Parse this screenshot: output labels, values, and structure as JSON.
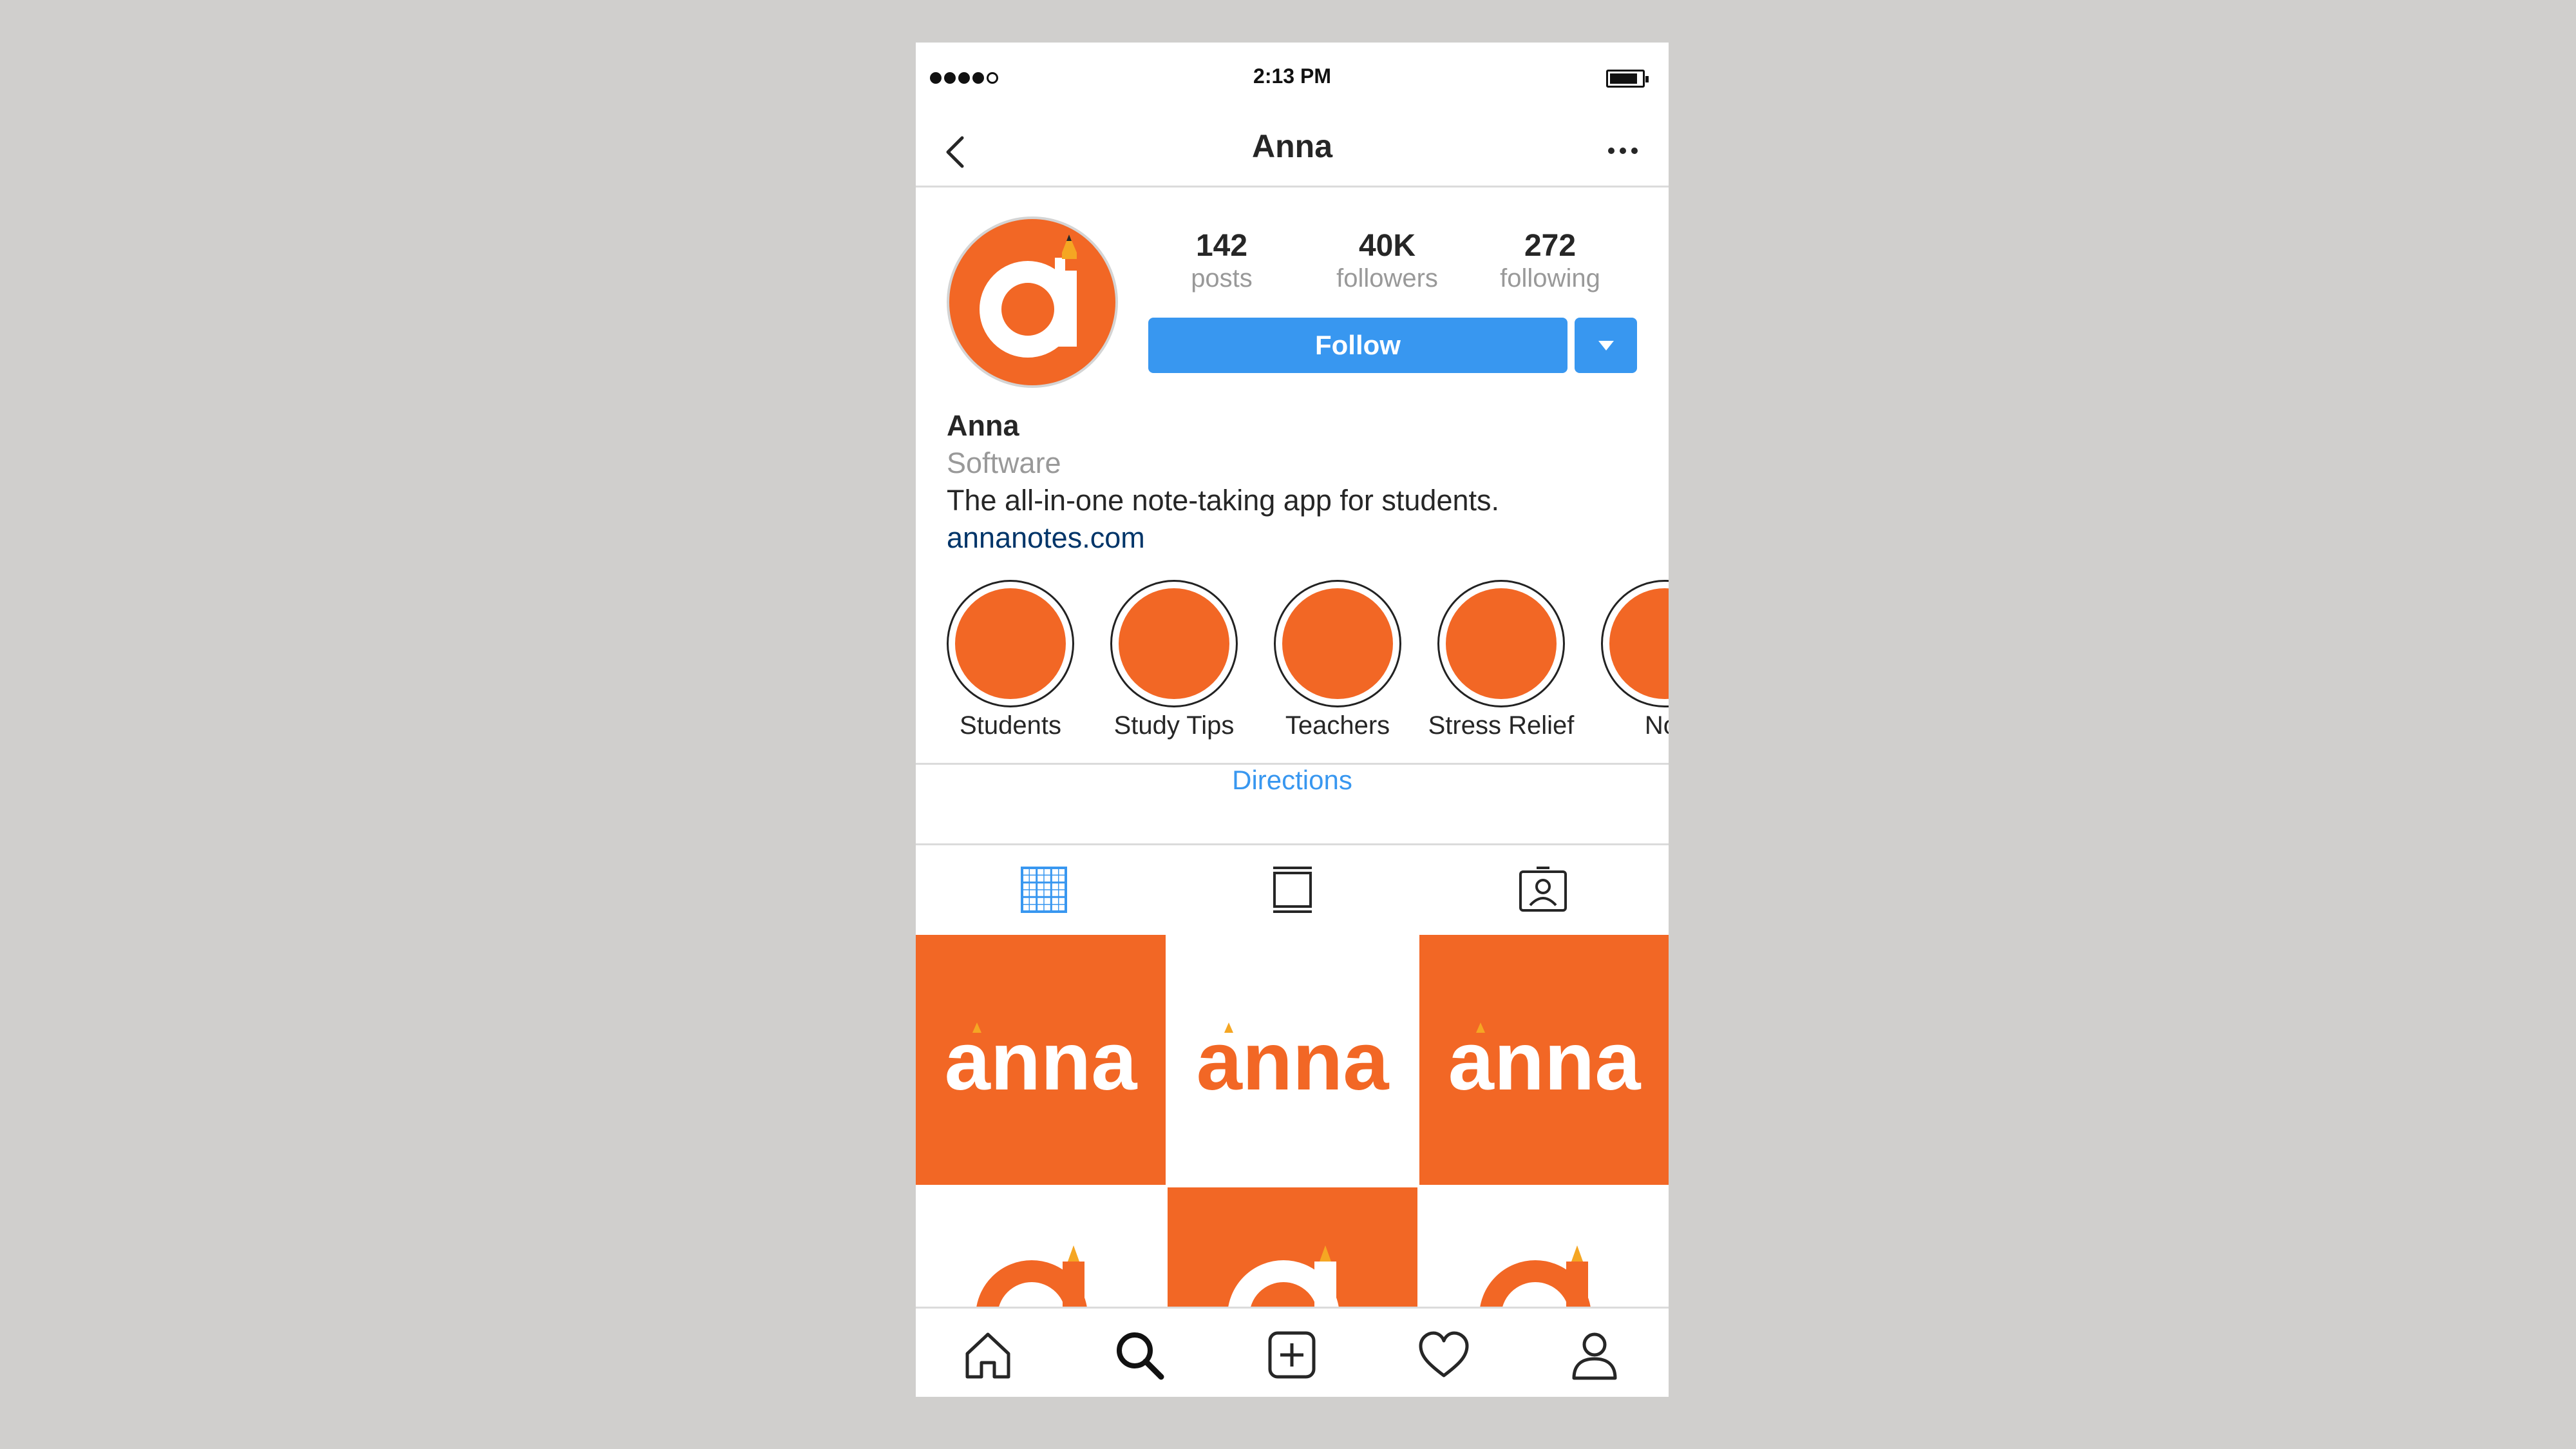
{
  "status_bar": {
    "time": "2:13 PM"
  },
  "header": {
    "title": "Anna"
  },
  "profile": {
    "stats": [
      {
        "value": "142",
        "label": "posts"
      },
      {
        "value": "40K",
        "label": "followers"
      },
      {
        "value": "272",
        "label": "following"
      }
    ],
    "follow_label": "Follow",
    "name": "Anna",
    "category": "Software",
    "bio": "The all-in-one note-taking app for students.",
    "website": "annanotes.com"
  },
  "highlights": [
    {
      "label": "Students"
    },
    {
      "label": "Study Tips"
    },
    {
      "label": "Teachers"
    },
    {
      "label": "Stress Relief"
    },
    {
      "label": "Not"
    }
  ],
  "directions_label": "Directions",
  "grid_posts": {
    "wordmark": "anna",
    "tiles": [
      "orange",
      "white",
      "orange",
      "white",
      "orange",
      "white"
    ]
  },
  "colors": {
    "brand": "#f26725",
    "accent": "#3897f0",
    "link": "#003569",
    "pencil": "#f5a623"
  },
  "icons": {
    "tabs": [
      "grid-icon",
      "feed-icon",
      "tagged-icon"
    ],
    "bottom_nav": [
      "home-icon",
      "search-icon",
      "add-icon",
      "heart-icon",
      "profile-icon"
    ]
  }
}
